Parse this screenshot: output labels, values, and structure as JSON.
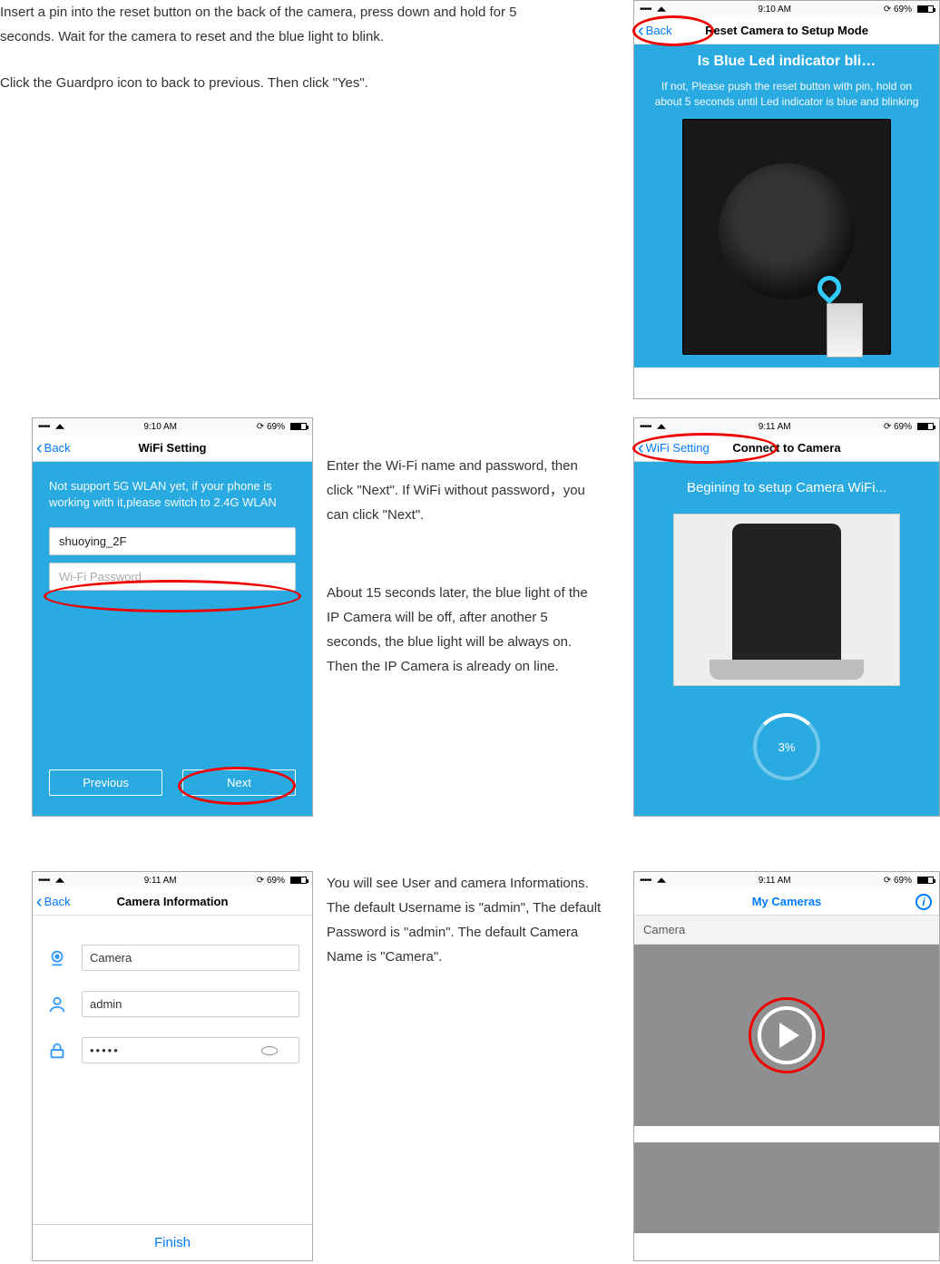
{
  "intro": {
    "p1": "Insert a pin into the reset button on the back of the camera, press down and hold for 5 seconds. Wait for the camera to reset and the blue light to blink.",
    "p2": "Click the Guardpro icon to back to previous. Then click \"Yes\"."
  },
  "status": {
    "time_910": "9:10 AM",
    "time_911": "9:11 AM",
    "battery": "69%"
  },
  "phone1": {
    "back": "Back",
    "title": "Reset Camera to Setup Mode",
    "heading": "Is Blue Led indicator bli…",
    "note": "If not, Please push the reset button with pin, hold on about 5 seconds until Led indicator is blue and blinking"
  },
  "phone2": {
    "back": "Back",
    "title": "WiFi Setting",
    "note": "Not support 5G WLAN yet, if your phone is working with it,please switch to 2.4G WLAN",
    "ssid": "shuoying_2F",
    "pwd_placeholder": "Wi-Fi Password",
    "prev": "Previous",
    "next": "Next"
  },
  "text2": {
    "p1": "Enter the Wi-Fi name and password, then click \"Next\". If WiFi without password，you can click \"Next\".",
    "p2": "About 15 seconds later, the blue light of the IP Camera will be off, after another 5 seconds, the blue light will be always on. Then the IP Camera is already on line."
  },
  "phone3": {
    "back": "WiFi Setting",
    "title": "Connect to Camera",
    "heading": "Begining to setup Camera WiFi...",
    "progress": "3%"
  },
  "phone4": {
    "back": "Back",
    "title": "Camera Information",
    "camera_name": "Camera",
    "username": "admin",
    "password_mask": "•••••",
    "finish": "Finish"
  },
  "text3": {
    "p1": "You will see User and camera Informations. The default Username is \"admin\", The default Password is \"admin\". The default Camera Name is \"Camera\"."
  },
  "phone5": {
    "title": "My Cameras",
    "label": "Camera"
  }
}
